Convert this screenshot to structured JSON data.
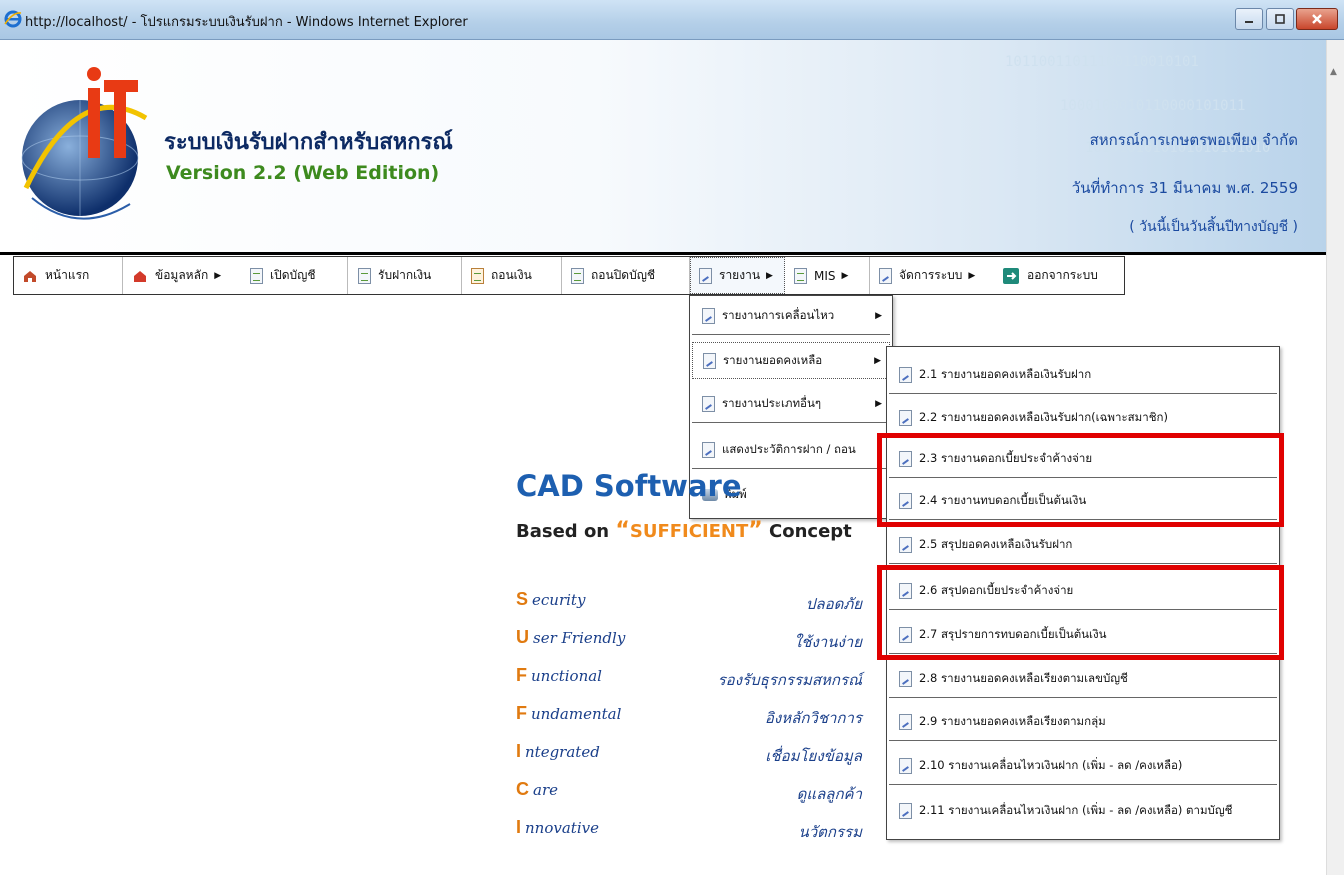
{
  "window": {
    "title": "http://localhost/ - โปรแกรมระบบเงินรับฝาก - Windows Internet Explorer"
  },
  "header": {
    "app_title": "ระบบเงินรับฝากสำหรับสหกรณ์",
    "version": "Version 2.2 (Web Edition)",
    "coop_name": "สหกรณ์การเกษตรพอเพียง จำกัด",
    "work_date": "วันที่ทำการ 31 มีนาคม พ.ศ. 2559",
    "year_end_note": "( วันนี้เป็นวันสิ้นปีทางบัญชี )",
    "binary_lines": [
      "10110011011100110010101",
      "1000100010110000101011",
      "1010101010101010101010"
    ]
  },
  "menu": {
    "home": "หน้าแรก",
    "master": "ข้อมูลหลัก",
    "open_account": "เปิดบัญชี",
    "deposit": "รับฝากเงิน",
    "withdraw": "ถอนเงิน",
    "close_account": "ถอนปิดบัญชี",
    "report": "รายงาน",
    "mis": "MIS",
    "system": "จัดการระบบ",
    "exit": "ออกจากระบบ"
  },
  "report_menu": [
    {
      "label": "รายงานการเคลื่อนไหว",
      "submenu": true
    },
    {
      "label": "รายงานยอดคงเหลือ",
      "submenu": true
    },
    {
      "label": "รายงานประเภทอื่นๆ",
      "submenu": true
    },
    {
      "label": "แสดงประวัติการฝาก / ถอน",
      "submenu": false
    },
    {
      "label": "พิมพ์",
      "submenu": false
    }
  ],
  "balance_submenu": [
    "2.1 รายงานยอดคงเหลือเงินรับฝาก",
    "2.2 รายงานยอดคงเหลือเงินรับฝาก(เฉพาะสมาชิก)",
    "2.3 รายงานดอกเบี้ยประจำค้างจ่าย",
    "2.4 รายงานทบดอกเบี้ยเป็นต้นเงิน",
    "2.5 สรุปยอดคงเหลือเงินรับฝาก",
    "2.6 สรุปดอกเบี้ยประจำค้างจ่าย",
    "2.7 สรุปรายการทบดอกเบี้ยเป็นต้นเงิน",
    "2.8 รายงานยอดคงเหลือเรียงตามเลขบัญชี",
    "2.9 รายงานยอดคงเหลือเรียงตามกลุ่ม",
    "2.10 รายงานเคลื่อนไหวเงินฝาก (เพิ่ม - ลด /คงเหลือ)",
    "2.11 รายงานเคลื่อนไหวเงินฝาก (เพิ่ม - ลด /คงเหลือ) ตามบัญชี"
  ],
  "content": {
    "cad_title": "CAD Software",
    "based_prefix": "Based on ",
    "quote_open": "“",
    "sufficient": "SUFFICIENT",
    "quote_close": "”",
    "concept": " Concept",
    "words": [
      {
        "cap": "S",
        "rest": "ecurity",
        "thai": "ปลอดภัย"
      },
      {
        "cap": "U",
        "rest": "ser Friendly",
        "thai": "ใช้งานง่าย"
      },
      {
        "cap": "F",
        "rest": "unctional",
        "thai": "รองรับธุรกรรมสหกรณ์"
      },
      {
        "cap": "F",
        "rest": "undamental",
        "thai": "อิงหลักวิชาการ"
      },
      {
        "cap": "I",
        "rest": "ntegrated",
        "thai": "เชื่อมโยงข้อมูล"
      },
      {
        "cap": "C",
        "rest": "are",
        "thai": "ดูแลลูกค้า"
      },
      {
        "cap": "I",
        "rest": "nnovative",
        "thai": "นวัตกรรม"
      }
    ]
  },
  "colors": {
    "highlight": "#e00000",
    "accent_blue": "#1d5fb0",
    "accent_orange": "#f08a1c",
    "version_green": "#3d8a1e"
  }
}
